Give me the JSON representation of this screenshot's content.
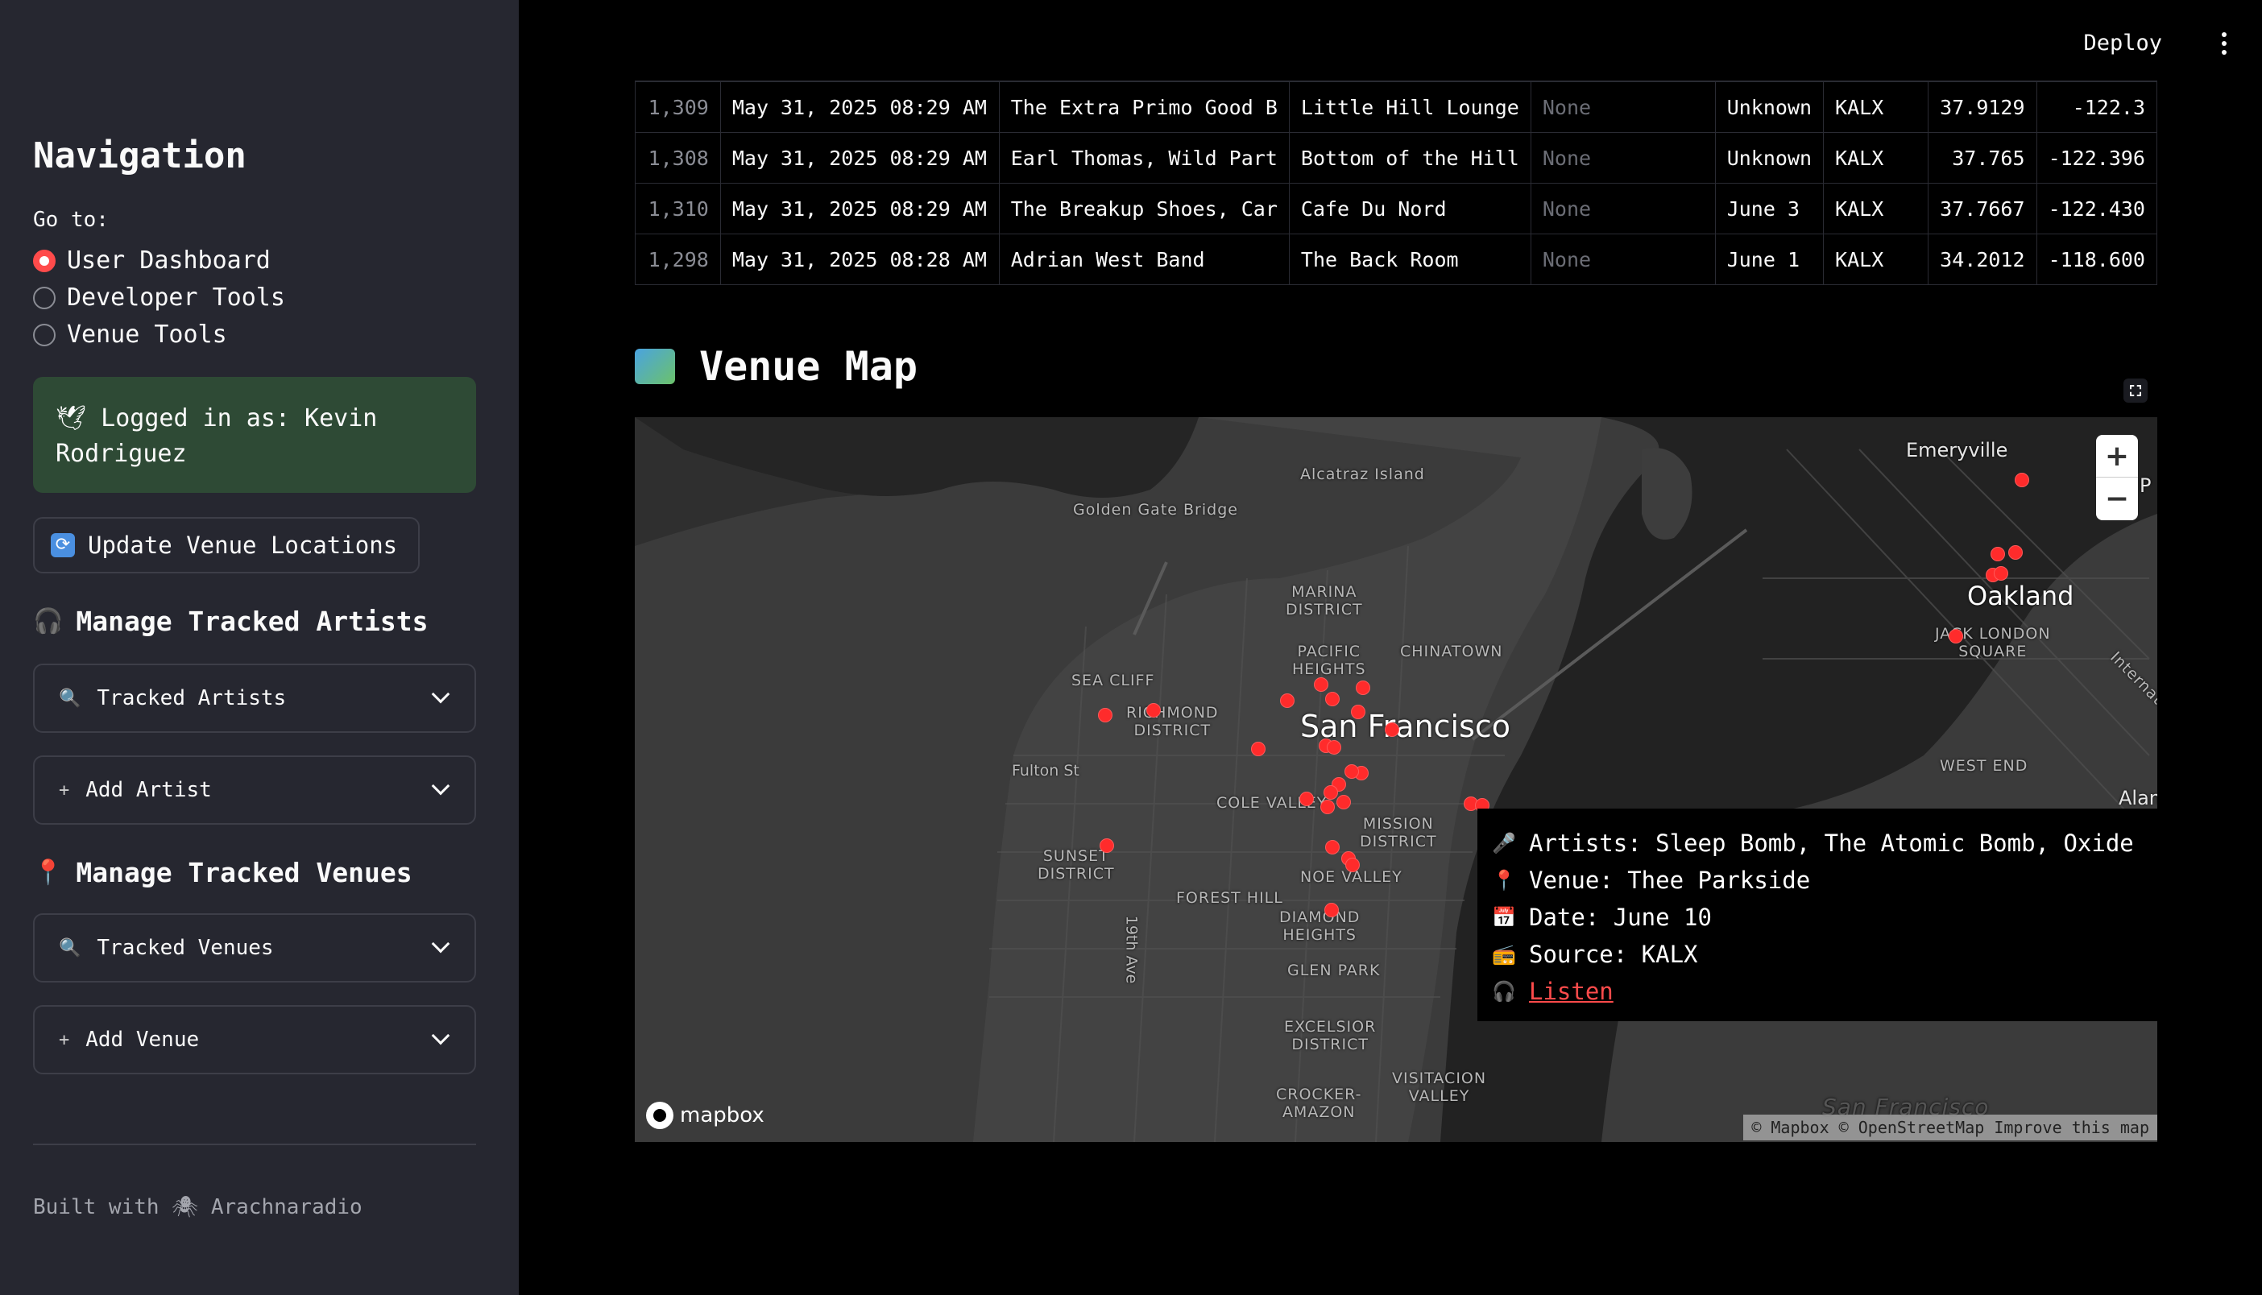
{
  "sidebar": {
    "nav_title": "Navigation",
    "goto_label": "Go to:",
    "options": [
      {
        "label": "User Dashboard",
        "selected": true
      },
      {
        "label": "Developer Tools",
        "selected": false
      },
      {
        "label": "Venue Tools",
        "selected": false
      }
    ],
    "login_icon": "bird-icon",
    "login_text": "Logged in as: Kevin Rodriguez",
    "update_button": "Update Venue Locations",
    "artists_header": "Manage Tracked Artists",
    "artists_expander": "Tracked Artists",
    "add_artist_expander": "Add Artist",
    "venues_header": "Manage Tracked Venues",
    "venues_expander": "Tracked Venues",
    "add_venue_expander": "Add Venue",
    "footer": "Built with 🕷 Arachnaradio"
  },
  "header": {
    "deploy_label": "Deploy"
  },
  "table": {
    "rows": [
      {
        "id": "1,309",
        "timestamp": "May 31, 2025 08:29 AM",
        "artists": "The Extra Primo Good B",
        "venue": "Little Hill Lounge",
        "link": "None",
        "date": "Unknown",
        "source": "KALX",
        "lat": "37.9129",
        "lon": "-122.3"
      },
      {
        "id": "1,308",
        "timestamp": "May 31, 2025 08:29 AM",
        "artists": "Earl Thomas, Wild Part",
        "venue": "Bottom of the Hill",
        "link": "None",
        "date": "Unknown",
        "source": "KALX",
        "lat": "37.765",
        "lon": "-122.396"
      },
      {
        "id": "1,310",
        "timestamp": "May 31, 2025 08:29 AM",
        "artists": "The Breakup Shoes, Car",
        "venue": "Cafe Du Nord",
        "link": "None",
        "date": "June 3",
        "source": "KALX",
        "lat": "37.7667",
        "lon": "-122.430"
      },
      {
        "id": "1,298",
        "timestamp": "May 31, 2025 08:28 AM",
        "artists": "Adrian West Band",
        "venue": "The Back Room",
        "link": "None",
        "date": "June 1",
        "source": "KALX",
        "lat": "34.2012",
        "lon": "-118.600"
      }
    ]
  },
  "map_section": {
    "title": "Venue Map",
    "labels": {
      "alcatraz": "Alcatraz Island",
      "golden_gate": "Golden Gate Bridge",
      "emeryville": "Emeryville",
      "oakland": "Oakland",
      "jack_london": "JACK LONDON\nSQUARE",
      "marina": "MARINA\nDISTRICT",
      "pacific_heights": "PACIFIC\nHEIGHTS",
      "chinatown": "CHINATOWN",
      "sea_cliff": "SEA CLIFF",
      "richmond": "RICHMOND\nDISTRICT",
      "san_francisco": "San Francisco",
      "fulton": "Fulton St",
      "cole_valley": "COLE VALLEY",
      "mission": "MISSION\nDISTRICT",
      "sunset": "SUNSET\nDISTRICT",
      "noe_valley": "NOE VALLEY",
      "forest_hill": "FOREST HILL",
      "diamond_heights": "DIAMOND\nHEIGHTS",
      "glen_park": "GLEN PARK",
      "excelsior": "EXCELSIOR\nDISTRICT",
      "crocker": "CROCKER-\nAMAZON",
      "visitacion": "VISITACION\nVALLEY",
      "west_end": "WEST END",
      "alameda": "Alam",
      "international": "Internatio",
      "nineteenth": "19th Ave",
      "sf_bay": "San Francisco",
      "p": "P"
    },
    "tooltip": {
      "artists": "Artists: Sleep Bomb, The Atomic Bomb, Oxide",
      "venue": "Venue: Thee Parkside",
      "date": "Date: June 10",
      "source": "Source: KALX",
      "listen": "Listen"
    },
    "mapbox_logo": "mapbox",
    "attribution": "© Mapbox © OpenStreetMap Improve this map",
    "zoom_in": "+",
    "zoom_out": "−"
  }
}
